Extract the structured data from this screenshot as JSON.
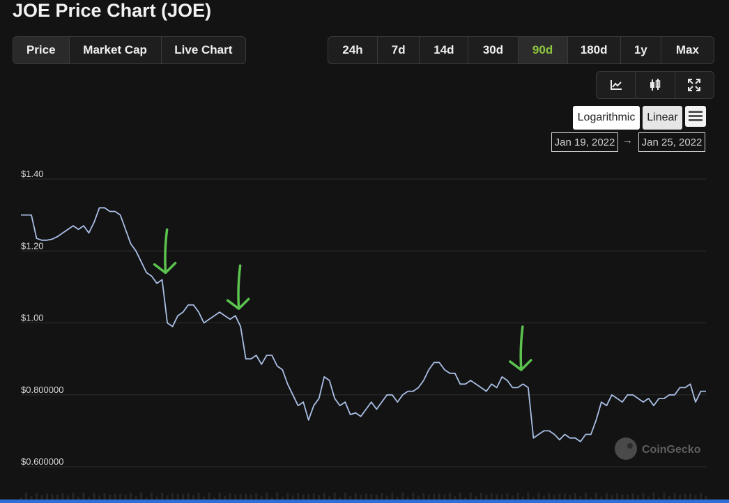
{
  "header": {
    "title": "JOE Price Chart (JOE)"
  },
  "chart_tabs": [
    "Price",
    "Market Cap",
    "Live Chart"
  ],
  "range_tabs": [
    "24h",
    "7d",
    "14d",
    "30d",
    "90d",
    "180d",
    "1y",
    "Max"
  ],
  "selected_range": "90d",
  "scale": {
    "log_label": "Logarithmic",
    "linear_label": "Linear"
  },
  "date_range": {
    "from": "Jan 19, 2022",
    "arrow": "→",
    "to": "Jan 25, 2022"
  },
  "watermark": "CoinGecko",
  "colors": {
    "accent": "#8dc63f",
    "line": "#aabfe6",
    "annotation": "#5cc34f",
    "background": "#131313"
  },
  "chart_data": {
    "type": "line",
    "title": "",
    "xlabel": "",
    "ylabel": "",
    "x_range": [
      "Jan 19, 2022",
      "Jan 25, 2022"
    ],
    "ylim": [
      0.6,
      1.4
    ],
    "y_ticks": [
      {
        "value": 1.4,
        "label": "$1.40"
      },
      {
        "value": 1.2,
        "label": "$1.20"
      },
      {
        "value": 1.0,
        "label": "$1.00"
      },
      {
        "value": 0.8,
        "label": "$0.800000"
      },
      {
        "value": 0.6,
        "label": "$0.600000"
      }
    ],
    "grid": true,
    "series": [
      {
        "values": [
          1.3,
          1.3,
          1.3,
          1.235,
          1.23,
          1.23,
          1.233,
          1.24,
          1.25,
          1.26,
          1.27,
          1.26,
          1.27,
          1.25,
          1.28,
          1.32,
          1.32,
          1.31,
          1.31,
          1.3,
          1.26,
          1.22,
          1.2,
          1.17,
          1.14,
          1.13,
          1.11,
          1.12,
          1.0,
          0.99,
          1.02,
          1.03,
          1.05,
          1.05,
          1.03,
          1.0,
          1.01,
          1.02,
          1.03,
          1.02,
          1.01,
          1.02,
          0.99,
          0.9,
          0.9,
          0.91,
          0.885,
          0.91,
          0.91,
          0.88,
          0.87,
          0.83,
          0.8,
          0.77,
          0.78,
          0.73,
          0.77,
          0.79,
          0.85,
          0.84,
          0.79,
          0.77,
          0.78,
          0.745,
          0.75,
          0.74,
          0.76,
          0.78,
          0.76,
          0.78,
          0.8,
          0.8,
          0.78,
          0.8,
          0.81,
          0.81,
          0.82,
          0.84,
          0.87,
          0.89,
          0.89,
          0.87,
          0.86,
          0.86,
          0.83,
          0.83,
          0.84,
          0.83,
          0.82,
          0.81,
          0.83,
          0.82,
          0.85,
          0.84,
          0.82,
          0.82,
          0.83,
          0.82,
          0.68,
          0.69,
          0.7,
          0.7,
          0.69,
          0.675,
          0.69,
          0.68,
          0.68,
          0.67,
          0.69,
          0.69,
          0.73,
          0.78,
          0.77,
          0.8,
          0.79,
          0.78,
          0.8,
          0.8,
          0.79,
          0.78,
          0.79,
          0.77,
          0.79,
          0.79,
          0.8,
          0.8,
          0.82,
          0.82,
          0.83,
          0.78,
          0.81,
          0.81
        ]
      }
    ],
    "annotations": [
      {
        "type": "arrow",
        "x_index": 27,
        "value": 1.12
      },
      {
        "type": "arrow",
        "x_index": 41,
        "value": 1.02
      },
      {
        "type": "arrow",
        "x_index": 95,
        "value": 0.85
      }
    ]
  }
}
